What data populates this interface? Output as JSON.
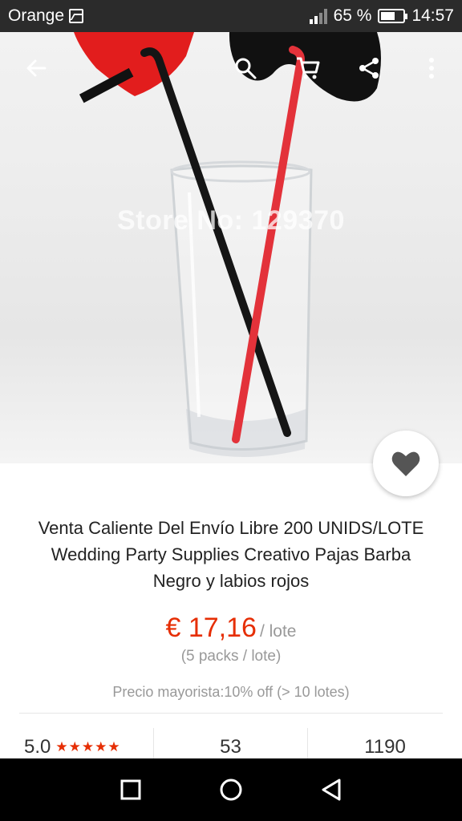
{
  "status_bar": {
    "carrier": "Orange",
    "battery": "65 %",
    "battery_level": 0.65,
    "time": "14:57"
  },
  "product_image": {
    "watermark": "Store No: 129370",
    "slide_count": 5,
    "active_slide": 1
  },
  "toolbar": {
    "back_icon": "arrow-left-icon",
    "search_icon": "search-icon",
    "cart_icon": "cart-icon",
    "share_icon": "share-icon",
    "more_icon": "more-vert-icon"
  },
  "product": {
    "title_lines": [
      "Venta Caliente Del Envío Libre 200 UNIDS/LOTE",
      "Wedding Party Supplies Creativo Pajas Barba",
      "Negro y labios rojos"
    ],
    "price": "€ 17,16",
    "price_unit": "/ lote",
    "packs": "(5 packs / lote)",
    "wholesale": "Precio mayorista:10% off (> 10 lotes)",
    "favorite_icon": "heart-icon"
  },
  "stats": {
    "rating": "5.0",
    "stars": "★★★★★",
    "stat_2": "53",
    "stat_3": "1190"
  },
  "colors": {
    "accent": "#e62e04",
    "status_bar": "#2b2b2b",
    "nav_bar": "#000000"
  },
  "nav_bar": {
    "recent_icon": "square-icon",
    "home_icon": "circle-icon",
    "back_icon": "triangle-back-icon"
  }
}
